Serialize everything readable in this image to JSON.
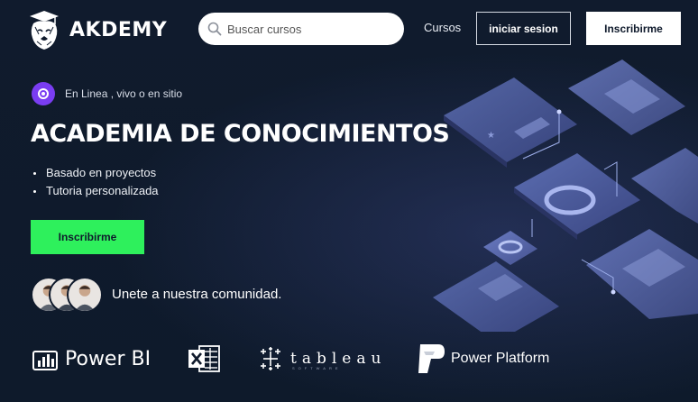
{
  "brand": {
    "name": "AKDEMY",
    "icon": "lion-logo-icon"
  },
  "nav": {
    "search_placeholder": "Buscar cursos",
    "link_courses": "Cursos",
    "login_label": "iniciar sesion",
    "signup_label": "Inscribirme"
  },
  "hero": {
    "tag": "En Linea , vivo o en sitio",
    "title": "ACADEMIA DE CONOCIMIENTOS",
    "bullets": [
      "Basado en proyectos",
      "Tutoria personalizada"
    ],
    "cta_label": "Inscribirme",
    "community": "Unete a nuestra comunidad."
  },
  "partners": {
    "powerbi": "Power BI",
    "tableau": "tableau",
    "tableau_sub": "SOFTWARE",
    "powerplatform": "Power Platform"
  },
  "colors": {
    "background": "#0f1a2c",
    "accent_green": "#2ef05c",
    "accent_purple": "#7a3df2"
  }
}
